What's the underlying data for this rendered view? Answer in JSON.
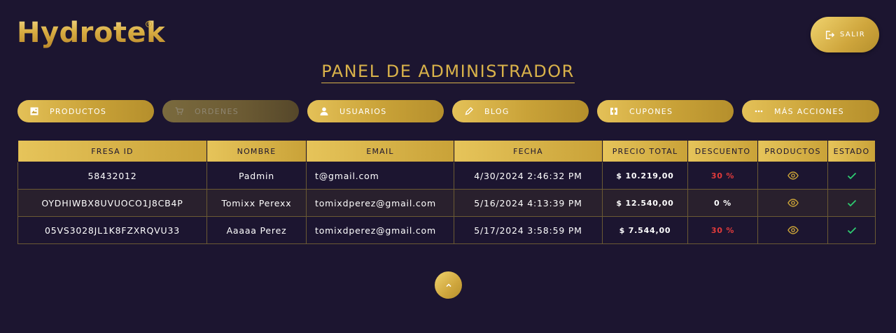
{
  "header": {
    "logo": "Hydrotek",
    "logo_mark": "R",
    "logout_label": "SALIR",
    "title": "PANEL DE ADMINISTRADOR"
  },
  "nav": [
    {
      "label": "PRODUCTOS",
      "icon": "image-icon"
    },
    {
      "label": "ORDENES",
      "icon": "cart-icon",
      "disabled": true
    },
    {
      "label": "USUARIOS",
      "icon": "user-icon"
    },
    {
      "label": "BLOG",
      "icon": "pencil-icon"
    },
    {
      "label": "CUPONES",
      "icon": "ticket-icon"
    },
    {
      "label": "MÁS ACCIONES",
      "icon": "dots-icon"
    }
  ],
  "table": {
    "headers": [
      "FRESA ID",
      "NOMBRE",
      "EMAIL",
      "FECHA",
      "PRECIO TOTAL",
      "DESCUENTO",
      "PRODUCTOS",
      "ESTADO"
    ],
    "rows": [
      {
        "id": "58432012",
        "name": "Padmin",
        "email": "t@gmail.com",
        "date": "4/30/2024 2:46:32 PM",
        "total": "$ 10.219,00",
        "discount": "30 %",
        "discount_color": "#e23b3b"
      },
      {
        "id": "OYDHIWBX8UVUOCO1J8CB4P",
        "name": "Tomixx Perexx",
        "email": "tomixdperez@gmail.com",
        "date": "5/16/2024 4:13:39 PM",
        "total": "$ 12.540,00",
        "discount": "0 %",
        "discount_color": "#ffffff"
      },
      {
        "id": "05VS3028JL1K8FZXRQVU33",
        "name": "Aaaaa Perez",
        "email": "tomixdperez@gmail.com",
        "date": "5/17/2024 3:58:59 PM",
        "total": "$ 7.544,00",
        "discount": "30 %",
        "discount_color": "#e23b3b"
      }
    ]
  },
  "colors": {
    "background": "#1c1530",
    "gold": "#c9a238",
    "check": "#2ecc71",
    "danger": "#e23b3b"
  }
}
